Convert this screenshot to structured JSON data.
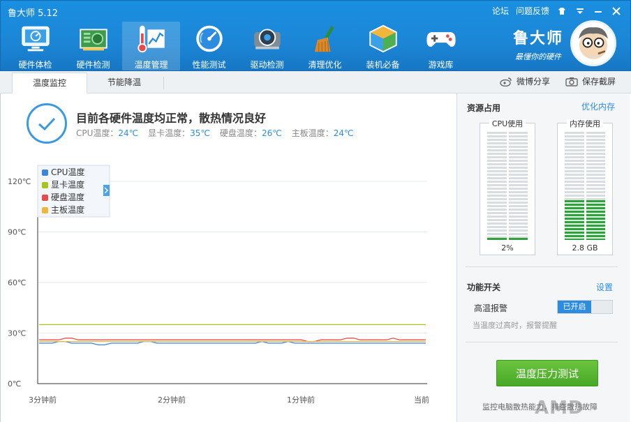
{
  "app": {
    "title": "鲁大师 5.12"
  },
  "top_links": {
    "forum": "论坛",
    "feedback": "问题反馈"
  },
  "nav": [
    {
      "label": "硬件体检",
      "icon": "monitor-check-icon"
    },
    {
      "label": "硬件检测",
      "icon": "circuit-board-icon"
    },
    {
      "label": "温度管理",
      "icon": "thermometer-chart-icon",
      "active": true
    },
    {
      "label": "性能测试",
      "icon": "speedometer-icon"
    },
    {
      "label": "驱动检测",
      "icon": "gear-chip-icon"
    },
    {
      "label": "清理优化",
      "icon": "broom-icon"
    },
    {
      "label": "装机必备",
      "icon": "cube-icon"
    },
    {
      "label": "游戏库",
      "icon": "gamepad-icon"
    }
  ],
  "brand": {
    "name": "鲁大师",
    "slogan": "最懂你的硬件"
  },
  "tabs": [
    {
      "label": "温度监控",
      "active": true
    },
    {
      "label": "节能降温",
      "active": false
    }
  ],
  "share": {
    "weibo": "微博分享",
    "screenshot": "保存截屏"
  },
  "status": {
    "title": "目前各硬件温度均正常，散热情况良好",
    "cpu_label": "CPU温度：",
    "cpu_value": "24℃",
    "gpu_label": "显卡温度：",
    "gpu_value": "35℃",
    "disk_label": "硬盘温度：",
    "disk_value": "26℃",
    "board_label": "主板温度：",
    "board_value": "24℃"
  },
  "chart_data": {
    "type": "line",
    "x_labels": [
      "3分钟前",
      "2分钟前",
      "1分钟前",
      "当前"
    ],
    "y_ticks": [
      "0℃",
      "30℃",
      "60℃",
      "90℃",
      "120℃"
    ],
    "ylim": [
      0,
      120
    ],
    "grid": true,
    "legend_position": "top-left",
    "series": [
      {
        "name": "CPU温度",
        "color": "#3b86d8",
        "values": [
          24,
          24,
          24,
          25,
          25,
          24,
          24,
          24,
          24,
          23,
          23,
          24,
          24,
          24,
          24,
          24,
          25,
          25,
          24,
          24,
          24,
          24,
          24,
          24,
          24,
          24,
          24,
          24,
          24,
          24,
          24,
          24,
          24,
          24,
          25,
          24,
          24,
          24,
          25,
          24,
          24,
          24,
          24,
          24,
          24,
          24,
          24,
          24,
          24,
          24,
          24,
          24,
          24,
          24,
          24,
          24,
          24,
          24,
          24,
          24
        ]
      },
      {
        "name": "显卡温度",
        "color": "#a8c31a",
        "values": [
          35,
          35,
          35,
          35,
          35,
          35,
          35,
          35,
          35,
          35,
          35,
          35,
          35,
          35,
          35,
          35,
          35,
          35,
          35,
          35,
          35,
          35,
          35,
          35,
          35,
          35,
          35,
          35,
          35,
          35,
          35,
          35,
          35,
          35,
          35,
          35,
          35,
          35,
          35,
          35,
          35,
          35,
          35,
          35,
          35,
          35,
          35,
          35,
          35,
          35,
          35,
          35,
          35,
          35,
          35,
          35,
          35,
          35,
          35,
          35
        ]
      },
      {
        "name": "硬盘温度",
        "color": "#e24e4e",
        "values": [
          26,
          26,
          26,
          26,
          27,
          27,
          26,
          26,
          26,
          26,
          26,
          26,
          26,
          26,
          26,
          26,
          26,
          26,
          26,
          26,
          26,
          26,
          26,
          26,
          26,
          26,
          26,
          26,
          26,
          26,
          26,
          26,
          26,
          26,
          26,
          26,
          26,
          26,
          26,
          26,
          26,
          25,
          25,
          26,
          26,
          26,
          26,
          27,
          27,
          26,
          26,
          26,
          26,
          26,
          27,
          26,
          26,
          26,
          26,
          26
        ]
      },
      {
        "name": "主板温度",
        "color": "#f2b63c",
        "values": [
          25,
          25,
          25,
          25,
          25,
          25,
          25,
          25,
          25,
          25,
          25,
          25,
          25,
          25,
          25,
          25,
          25,
          25,
          25,
          25,
          25,
          25,
          25,
          25,
          25,
          25,
          25,
          25,
          25,
          25,
          25,
          25,
          25,
          25,
          25,
          25,
          25,
          25,
          25,
          25,
          25,
          25,
          25,
          25,
          25,
          25,
          25,
          25,
          25,
          25,
          25,
          25,
          25,
          25,
          25,
          25,
          25,
          25,
          25,
          25
        ]
      }
    ]
  },
  "resources": {
    "title": "资源占用",
    "optimize_link": "优化内存",
    "cpu": {
      "label": "CPU使用",
      "value": "2%",
      "fraction": 0.02
    },
    "memory": {
      "label": "内存使用",
      "value": "2.8 GB",
      "fraction": 0.37
    }
  },
  "functions": {
    "title": "功能开关",
    "settings_link": "设置",
    "alarm_label": "高温报警",
    "alarm_state": "已开启",
    "alarm_desc": "当温度过高时，报警提醒"
  },
  "stress_button": "温度压力测试",
  "footnote": "监控电脑散热能力，排查散热故障",
  "watermark": "AMD"
}
